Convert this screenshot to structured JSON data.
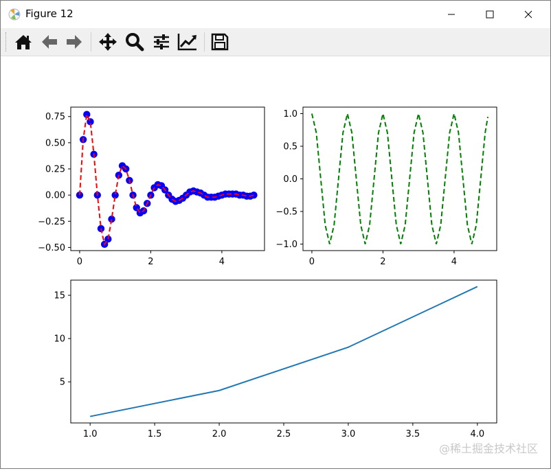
{
  "window": {
    "title": "Figure 12",
    "buttons": [
      "minimize",
      "maximize",
      "close"
    ]
  },
  "toolbar": {
    "items": [
      "home-icon",
      "back-icon",
      "forward-icon",
      "pan-icon",
      "zoom-icon",
      "configure-subplots-icon",
      "edit-axis-icon",
      "save-icon"
    ]
  },
  "watermark": "@稀土掘金技术社区",
  "colors": {
    "red": "#ff0000",
    "blue": "#0000ff",
    "green": "#008000",
    "line": "#1f77b4"
  },
  "chart_data": [
    {
      "type": "scatter",
      "title": "",
      "xlabel": "",
      "ylabel": "",
      "xlim": [
        -0.25,
        5.2
      ],
      "ylim": [
        -0.53,
        0.84
      ],
      "xticks": [
        0,
        2,
        4
      ],
      "yticks": [
        0.75,
        0.5,
        0.25,
        0.0,
        -0.25,
        -0.5
      ],
      "ytick_labels": [
        "0.75",
        "0.50",
        "0.25",
        "0.00",
        "−0.25",
        "−0.50"
      ],
      "grid": false,
      "series": [
        {
          "style": "markers",
          "color": "#0000ff",
          "x": [
            0,
            0.1,
            0.2,
            0.3,
            0.4,
            0.5,
            0.6,
            0.7,
            0.8,
            0.9,
            1.0,
            1.1,
            1.2,
            1.3,
            1.4,
            1.5,
            1.6,
            1.7,
            1.8,
            1.9,
            2.0,
            2.1,
            2.2,
            2.3,
            2.4,
            2.5,
            2.6,
            2.7,
            2.8,
            2.9,
            3.0,
            3.1,
            3.2,
            3.3,
            3.4,
            3.5,
            3.6,
            3.7,
            3.8,
            3.9,
            4.0,
            4.1,
            4.2,
            4.3,
            4.4,
            4.5,
            4.6,
            4.7,
            4.8,
            4.9
          ],
          "y": [
            0,
            0.53,
            0.77,
            0.7,
            0.39,
            0.0,
            -0.32,
            -0.47,
            -0.42,
            -0.23,
            0.0,
            0.19,
            0.28,
            0.25,
            0.14,
            0.0,
            -0.12,
            -0.17,
            -0.15,
            -0.08,
            0.0,
            0.07,
            0.1,
            0.09,
            0.05,
            0.0,
            -0.04,
            -0.06,
            -0.05,
            -0.03,
            0.0,
            0.03,
            0.04,
            0.03,
            0.02,
            0.0,
            -0.02,
            -0.02,
            -0.02,
            -0.01,
            0.0,
            0.01,
            0.01,
            0.01,
            0.01,
            0.0,
            0.0,
            -0.01,
            -0.01,
            0.0
          ]
        },
        {
          "style": "dashed",
          "color": "#ff0000",
          "x": [
            0,
            0.1,
            0.2,
            0.3,
            0.4,
            0.5,
            0.6,
            0.7,
            0.8,
            0.9,
            1.0,
            1.1,
            1.2,
            1.3,
            1.4,
            1.5,
            1.6,
            1.7,
            1.8,
            1.9,
            2.0,
            2.1,
            2.2,
            2.3,
            2.4,
            2.5,
            2.6,
            2.7,
            2.8,
            2.9,
            3.0,
            3.1,
            3.2,
            3.3,
            3.4,
            3.5,
            3.6,
            3.7,
            3.8,
            3.9,
            4.0,
            4.1,
            4.2,
            4.3,
            4.4,
            4.5,
            4.6,
            4.7,
            4.8,
            4.9
          ],
          "y": [
            0,
            0.53,
            0.77,
            0.7,
            0.39,
            0.0,
            -0.32,
            -0.47,
            -0.42,
            -0.23,
            0.0,
            0.19,
            0.28,
            0.25,
            0.14,
            0.0,
            -0.12,
            -0.17,
            -0.15,
            -0.08,
            0.0,
            0.07,
            0.1,
            0.09,
            0.05,
            0.0,
            -0.04,
            -0.06,
            -0.05,
            -0.03,
            0.0,
            0.03,
            0.04,
            0.03,
            0.02,
            0.0,
            -0.02,
            -0.02,
            -0.02,
            -0.01,
            0.0,
            0.01,
            0.01,
            0.01,
            0.01,
            0.0,
            0.0,
            -0.01,
            -0.01,
            0.0
          ]
        }
      ]
    },
    {
      "type": "line",
      "title": "",
      "xlabel": "",
      "ylabel": "",
      "xlim": [
        -0.25,
        5.2
      ],
      "ylim": [
        -1.1,
        1.1
      ],
      "xticks": [
        0,
        2,
        4
      ],
      "yticks": [
        1.0,
        0.5,
        0.0,
        -0.5,
        -1.0
      ],
      "ytick_labels": [
        "1.0",
        "0.5",
        "0.0",
        "−0.5",
        "−1.0"
      ],
      "grid": false,
      "series": [
        {
          "style": "dashed",
          "color": "#008000",
          "x": [
            0,
            0.125,
            0.25,
            0.375,
            0.5,
            0.625,
            0.75,
            0.875,
            1.0,
            1.125,
            1.25,
            1.375,
            1.5,
            1.625,
            1.75,
            1.875,
            2.0,
            2.125,
            2.25,
            2.375,
            2.5,
            2.625,
            2.75,
            2.875,
            3.0,
            3.125,
            3.25,
            3.375,
            3.5,
            3.625,
            3.75,
            3.875,
            4.0,
            4.125,
            4.25,
            4.375,
            4.5,
            4.625,
            4.75,
            4.875,
            4.95
          ],
          "y": [
            1.0,
            0.707,
            0.0,
            -0.707,
            -1.0,
            -0.707,
            0.0,
            0.707,
            1.0,
            0.707,
            0.0,
            -0.707,
            -1.0,
            -0.707,
            0.0,
            0.707,
            1.0,
            0.707,
            0.0,
            -0.707,
            -1.0,
            -0.707,
            0.0,
            0.707,
            1.0,
            0.707,
            0.0,
            -0.707,
            -1.0,
            -0.707,
            0.0,
            0.707,
            1.0,
            0.707,
            0.0,
            -0.707,
            -1.0,
            -0.707,
            0.0,
            0.707,
            0.951
          ]
        }
      ]
    },
    {
      "type": "line",
      "title": "",
      "xlabel": "",
      "ylabel": "",
      "xlim": [
        0.85,
        4.15
      ],
      "ylim": [
        0.25,
        16.75
      ],
      "xticks": [
        1.0,
        1.5,
        2.0,
        2.5,
        3.0,
        3.5,
        4.0
      ],
      "xtick_labels": [
        "1.0",
        "1.5",
        "2.0",
        "2.5",
        "3.0",
        "3.5",
        "4.0"
      ],
      "yticks": [
        15,
        10,
        5
      ],
      "ytick_labels": [
        "15",
        "10",
        "5"
      ],
      "grid": false,
      "series": [
        {
          "style": "solid",
          "color": "#1f77b4",
          "x": [
            1,
            2,
            3,
            4
          ],
          "y": [
            1,
            4,
            9,
            16
          ]
        }
      ]
    }
  ]
}
